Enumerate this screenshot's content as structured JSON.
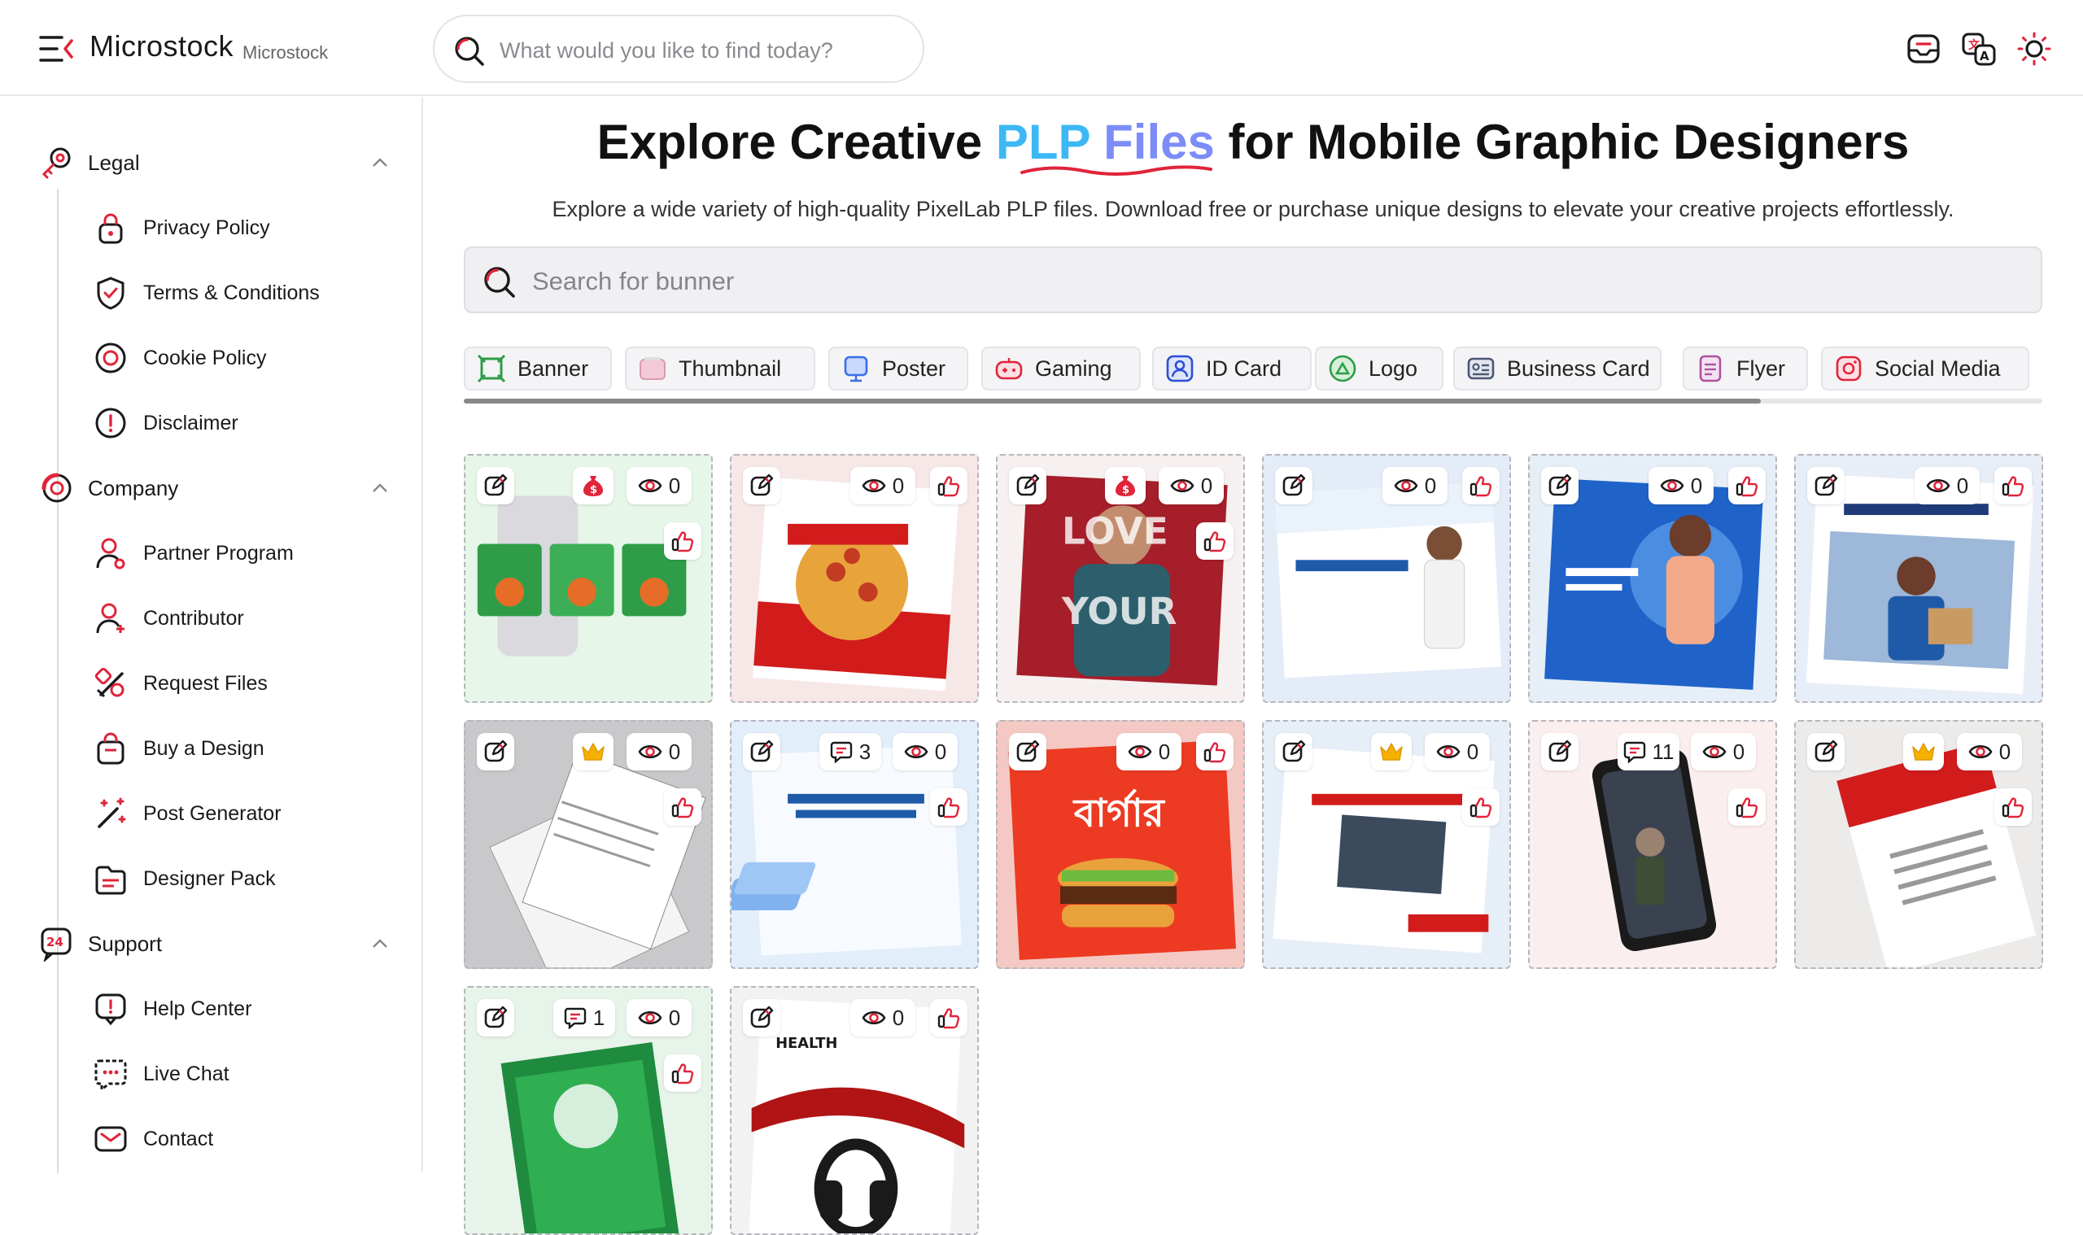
{
  "header": {
    "brand": "Microstock",
    "brand_sub": "Microstock",
    "search_placeholder": "What would you like to find today?"
  },
  "sidebar": {
    "groups": [
      {
        "label": "Legal",
        "items": [
          "Privacy Policy",
          "Terms & Conditions",
          "Cookie Policy",
          "Disclaimer"
        ]
      },
      {
        "label": "Company",
        "items": [
          "Partner Program",
          "Contributor",
          "Request Files",
          "Buy a Design",
          "Post Generator",
          "Designer Pack"
        ]
      },
      {
        "label": "Support",
        "items": [
          "Help Center",
          "Live Chat",
          "Contact"
        ]
      }
    ]
  },
  "main": {
    "title_pre": "Explore Creative ",
    "title_hl1": "PLP ",
    "title_hl2": "Files",
    "title_post": " for Mobile Graphic Designers",
    "subtitle": "Explore a wide variety of high-quality PixelLab PLP files. Download free or purchase unique designs to elevate your creative projects effortlessly.",
    "search_placeholder": "Search for bunner",
    "categories": [
      "Banner",
      "Thumbnail",
      "Poster",
      "Gaming",
      "ID Card",
      "Logo",
      "Business Card",
      "Flyer",
      "Social Media"
    ]
  },
  "cards": [
    {
      "views": "0",
      "comments": null,
      "badge": "money",
      "bg": "#e6f6e8"
    },
    {
      "views": "0",
      "comments": null,
      "badge": null,
      "bg": "#f7e8e8"
    },
    {
      "views": "0",
      "comments": null,
      "badge": "money",
      "bg": "#f6f0f0"
    },
    {
      "views": "0",
      "comments": null,
      "badge": null,
      "bg": "#e4edf7"
    },
    {
      "views": "0",
      "comments": null,
      "badge": null,
      "bg": "#e6eef8"
    },
    {
      "views": "0",
      "comments": null,
      "badge": null,
      "bg": "#e8eef8"
    },
    {
      "views": "0",
      "comments": null,
      "badge": "crown",
      "bg": "#c9c9cc"
    },
    {
      "views": "0",
      "comments": "3",
      "badge": null,
      "bg": "#e2eefa"
    },
    {
      "views": "0",
      "comments": null,
      "badge": null,
      "bg": "#f4c9c4"
    },
    {
      "views": "0",
      "comments": null,
      "badge": "crown",
      "bg": "#e6eef8"
    },
    {
      "views": "0",
      "comments": "11",
      "badge": null,
      "bg": "#fbeeee"
    },
    {
      "views": "0",
      "comments": null,
      "badge": "crown",
      "bg": "#ecebea"
    },
    {
      "views": "0",
      "comments": "1",
      "badge": null,
      "bg": "#e7f4ea"
    },
    {
      "views": "0",
      "comments": null,
      "badge": null,
      "bg": "#f3f2f2"
    }
  ],
  "colors": {
    "accent": "#e0243a",
    "highlight_blue": "#3db8f5",
    "highlight_violet": "#7c8cf8"
  }
}
